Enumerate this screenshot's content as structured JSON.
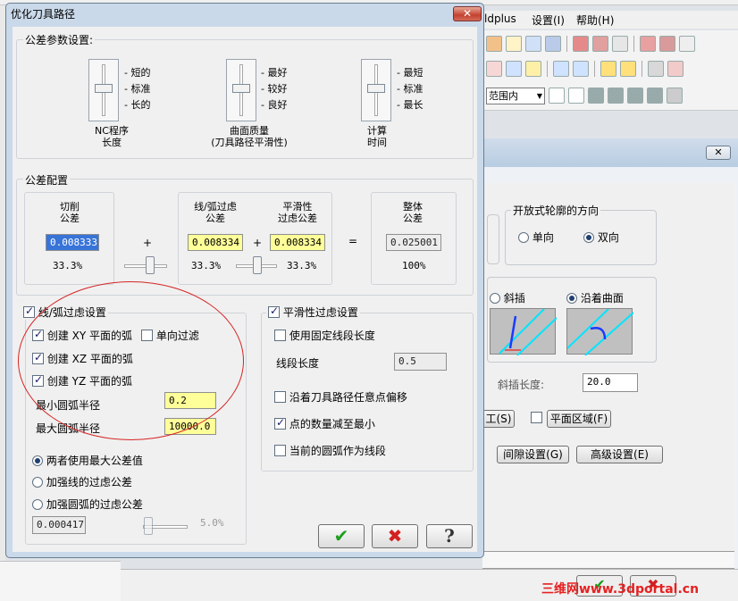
{
  "background_app": {
    "menu": [
      "ldplus",
      "设置(I)",
      "帮助(H)"
    ],
    "toolbar_select": "范围内",
    "dialog2": {
      "close_label": "✕",
      "open_contour_group": "开放式轮廓的方向",
      "radio_single": "单向",
      "radio_double": "双向",
      "radio_oblique": "斜插",
      "radio_along_surface": "沿着曲面",
      "oblique_length_label": "斜插长度:",
      "oblique_length_value": "20.0",
      "partial_label": "工(S)",
      "plane_region_label": "平面区域(F)",
      "gap_settings_button": "间隙设置(G)",
      "advanced_settings_button": "高级设置(E)"
    },
    "watermark": "三维网www.3dportal.cn"
  },
  "dialog": {
    "title": "优化刀具路径",
    "close_label": "✕",
    "tolerance_params": {
      "label": "公差参数设置:",
      "nc": {
        "ticks": [
          "短的",
          "标准",
          "长的"
        ],
        "caption_line1": "NC程序",
        "caption_line2": "长度"
      },
      "surface": {
        "ticks": [
          "最好",
          "较好",
          "良好"
        ],
        "caption_line1": "曲面质量",
        "caption_line2": "(刀具路径平滑性)"
      },
      "compute": {
        "ticks": [
          "最短",
          "标准",
          "最长"
        ],
        "caption_line1": "计算",
        "caption_line2": "时间"
      }
    },
    "tolerance_config": {
      "label": "公差配置",
      "cut": {
        "label_line1": "切削",
        "label_line2": "公差",
        "value": "0.008333",
        "percent": "33.3%"
      },
      "plus1": "+",
      "arc": {
        "label_line1": "线/弧过虑",
        "label_line2": "公差",
        "value": "0.008334",
        "percent": "33.3%"
      },
      "plus2": "+",
      "smooth": {
        "label_line1": "平滑性",
        "label_line2": "过虑公差",
        "value": "0.008334",
        "percent": "33.3%"
      },
      "equals": "=",
      "total": {
        "label_line1": "整体",
        "label_line2": "公差",
        "value": "0.025001",
        "percent": "100%"
      }
    },
    "line_arc": {
      "label": "线/弧过虑设置",
      "xy_label": "创建 XY 平面的弧",
      "single_filter_label": "单向过滤",
      "xz_label": "创建 XZ 平面的弧",
      "yz_label": "创建 YZ 平面的弧",
      "min_radius_label": "最小圆弧半径",
      "min_radius_value": "0.2",
      "max_radius_label": "最大圆弧半径",
      "max_radius_value": "10000.0",
      "opt_both": "两者使用最大公差值",
      "opt_line": "加强线的过虑公差",
      "opt_arc": "加强圆弧的过虑公差",
      "bottom_value": "0.000417",
      "bottom_percent": "5.0%"
    },
    "smooth_filter": {
      "label": "平滑性过虑设置",
      "fixed_seg_label": "使用固定线段长度",
      "seg_length_label": "线段长度",
      "seg_length_value": "0.5",
      "offset_label": "沿着刀具路径任意点偏移",
      "reduce_points_label": "点的数量减至最小",
      "current_arc_label": "当前的圆弧作为线段"
    },
    "buttons": {
      "ok": "✔",
      "cancel": "✖",
      "help": "?"
    }
  }
}
